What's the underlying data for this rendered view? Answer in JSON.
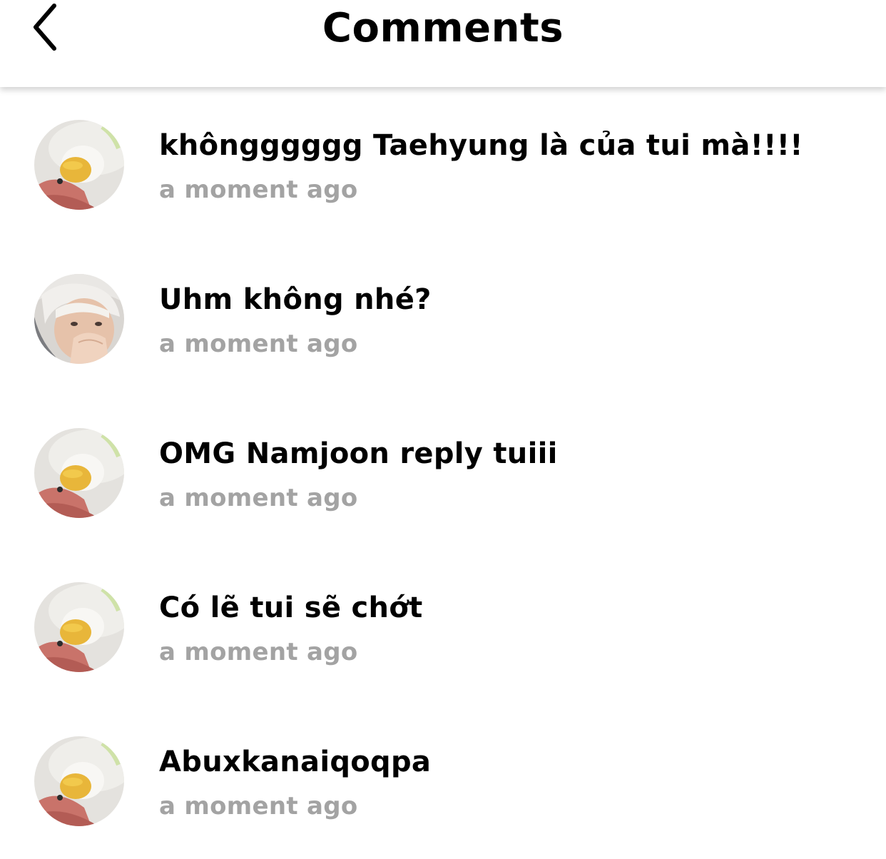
{
  "header": {
    "title": "Comments",
    "back_icon": "chevron-left-icon"
  },
  "colors": {
    "text": "#000000",
    "timestamp": "#a3a3a3",
    "background": "#ffffff"
  },
  "comments": [
    {
      "avatar": "duck-plush-avatar",
      "text": "khôngggggg Taehyung là của tui mà!!!!",
      "time": "a moment ago"
    },
    {
      "avatar": "person-avatar",
      "text": "Uhm không nhé?",
      "time": "a moment ago"
    },
    {
      "avatar": "duck-plush-avatar",
      "text": "OMG Namjoon reply tuiii",
      "time": "a moment ago"
    },
    {
      "avatar": "duck-plush-avatar",
      "text": "Có lẽ tui sẽ chớt",
      "time": "a moment ago"
    },
    {
      "avatar": "duck-plush-avatar",
      "text": "Abuxkanaiqoqpa",
      "time": "a moment ago"
    }
  ]
}
